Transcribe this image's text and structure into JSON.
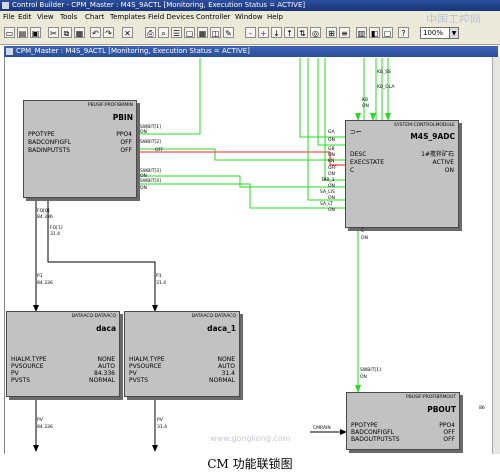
{
  "app": {
    "title": "Control Builder - CPM_Master : M4S_9ACTL [Monitoring, Execution Status = ACTIVE]",
    "watermark": "中国工控网"
  },
  "menu": [
    "File",
    "Edit",
    "View",
    "Tools",
    "Chart",
    "Templates",
    "Field Devices",
    "Controller",
    "Window",
    "Help"
  ],
  "toolbar": {
    "zoom": "100%"
  },
  "inner_window": {
    "title": "CPM_Master : M4S_9ACTL [Monitoring, Execution Status = ACTIVE]"
  },
  "blocks": {
    "pbin": {
      "header": "PBUSIF:PROFIBRMIN",
      "name": "PBIN",
      "rows": [
        {
          "k": "PPOTYPE",
          "v": "PPO4"
        },
        {
          "k": "BADCONFIGFL",
          "v": "OFF"
        },
        {
          "k": "BADINPUTSTS",
          "v": "OFF"
        }
      ]
    },
    "sysctrl": {
      "header": "SYSTEM:CONTROLMODULE",
      "name": "M4S_9ADC",
      "rows": [
        {
          "k": "DESC",
          "v": "1#搅拌矿石"
        },
        {
          "k": "EXECSTATE",
          "v": "ACTIVE"
        },
        {
          "k": "C",
          "v": "ON"
        }
      ]
    },
    "daca": {
      "header": "DATAACQ:DATAACQ",
      "name": "daca",
      "rows": [
        {
          "k": "HIALM.TYPE",
          "v": "NONE"
        },
        {
          "k": "PVSOURCE",
          "v": "AUTO"
        },
        {
          "k": "PV",
          "v": "84.336"
        },
        {
          "k": "PVSTS",
          "v": "NORMAL"
        }
      ]
    },
    "daca1": {
      "header": "DATAACQ:DATAACQ",
      "name": "daca_1",
      "rows": [
        {
          "k": "HIALM.TYPE",
          "v": "NONE"
        },
        {
          "k": "PVSOURCE",
          "v": "AUTO"
        },
        {
          "k": "PV",
          "v": "31.4"
        },
        {
          "k": "PVSTS",
          "v": "NORMAL"
        }
      ]
    },
    "pbout": {
      "header": "PBUSIF:PROFIBRMOUT",
      "name": "PBOUT",
      "rows": [
        {
          "k": "PPOTYPE",
          "v": "PPO4"
        },
        {
          "k": "BADCONFIGFL",
          "v": "OFF"
        },
        {
          "k": "BADOUTPUTSTS",
          "v": "OFF"
        }
      ]
    }
  },
  "wire_labels": {
    "pbin_out1": "SWBIT[1]",
    "pbin_out1_v": "ON",
    "pbin_out2": "SWBIT[2]",
    "pbin_out2_v": "OFF",
    "pbin_out3": "SWBIT[3]",
    "pbin_out3_v": "ON",
    "pbin_out4": "SWBIT[4]",
    "pbin_out4_v": "ON",
    "sys_in_ga": "GA",
    "sys_in_ga_v": "ON",
    "sys_in_gb": "GB",
    "sys_in_gb_v": "ON",
    "sys_in_kn": "KN",
    "sys_in_kn_v": "OFF",
    "sys_in_kn2": "KN",
    "sys_in_kn2_v": "ON",
    "sys_in_bir": "BIR_1",
    "sys_in_bir_v": "ON",
    "sys_in_sa": "SA_LIS",
    "sys_in_sa_v": "ON",
    "sys_in_sa2": "SA_LT",
    "sys_in_sa2_v": "ON",
    "sys_top_1": "KB_SS",
    "sys_top_2": "KB_GLA",
    "sys_top_3": "KB",
    "sys_top_4": "ON",
    "sys_out_c": "C",
    "sys_out_c_v": "ON",
    "f0_1": "FO[0]",
    "f0_1v": "84.336",
    "f0_2": "FO[1]",
    "f0_2v": "31.4",
    "p1": "P1",
    "p1v": "84.336",
    "p2": "P1",
    "p2v": "31.4",
    "pv1": "PV",
    "pv1v": "84.336",
    "pv2": "PV",
    "pv2v": "31.4",
    "swbit_out": "SWBIT[1]",
    "swbit_out_v": "ON",
    "cmrain": "CMRAIN",
    "num_r": "86"
  },
  "caption": "CM 功能联锁图",
  "site_watermark": "www.gongkong.com"
}
